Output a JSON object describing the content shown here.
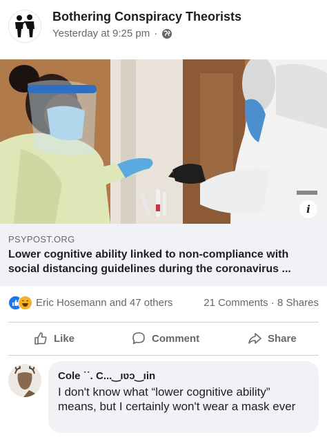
{
  "post": {
    "page_name": "Bothering Conspiracy Theorists",
    "timestamp": "Yesterday at 9:25 pm",
    "separator": "·",
    "privacy_icon": "globe-icon"
  },
  "image": {
    "info_icon": "i"
  },
  "link_preview": {
    "domain": "PSYPOST.ORG",
    "title": "Lower cognitive ability linked to non-compliance with social distancing guidelines during the coronavirus ..."
  },
  "reactions": {
    "icons": [
      "like-reaction-icon",
      "haha-reaction-icon"
    ],
    "names": "Eric Hosemann and 47 others",
    "comments": "21 Comments",
    "separator": "·",
    "shares": "8 Shares"
  },
  "actions": {
    "like": "Like",
    "comment": "Comment",
    "share": "Share"
  },
  "comment": {
    "author": "Cole ˙˙. C...‿ıʋɔ‿ıin",
    "text": "I don't know what “lower cognitive ability” means, but I certainly won't wear a mask ever"
  }
}
